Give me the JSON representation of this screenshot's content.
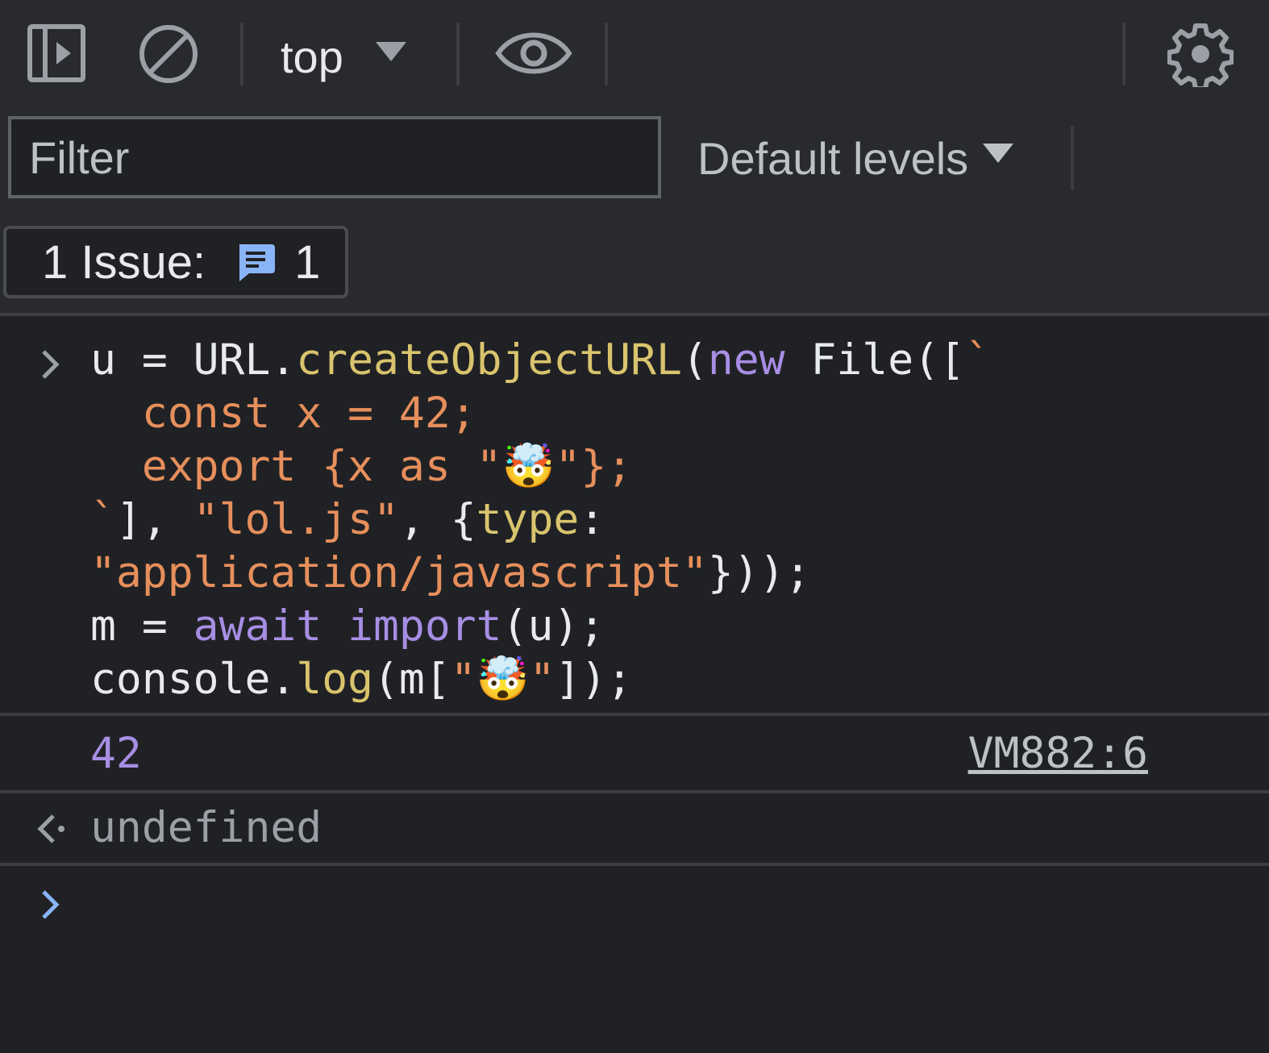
{
  "toolbar": {
    "sidebar_toggle_icon": "sidebar-toggle-icon",
    "clear_icon": "clear-console-icon",
    "context_label": "top",
    "live_expression_icon": "eye-icon",
    "settings_icon": "gear-icon"
  },
  "filter": {
    "placeholder": "Filter",
    "value": "",
    "levels_label": "Default levels"
  },
  "issues": {
    "label": "1 Issue:",
    "icon": "message-icon",
    "count": "1",
    "icon_color": "#8ab4f8"
  },
  "console": {
    "input_code_lines": [
      [
        {
          "text": "u = URL.",
          "kind": "plain"
        },
        {
          "text": "createObjectURL",
          "kind": "fn"
        },
        {
          "text": "(",
          "kind": "punc"
        },
        {
          "text": "new",
          "kind": "kw"
        },
        {
          "text": " File([",
          "kind": "plain"
        },
        {
          "text": "`",
          "kind": "tmpl"
        }
      ],
      [
        {
          "text": "  const x = 42;",
          "kind": "str"
        }
      ],
      [
        {
          "text": "  export {x as \"🤯\"};",
          "kind": "str"
        }
      ],
      [
        {
          "text": "`",
          "kind": "tmpl"
        },
        {
          "text": "], ",
          "kind": "plain"
        },
        {
          "text": "\"lol.js\"",
          "kind": "str"
        },
        {
          "text": ", {",
          "kind": "plain"
        },
        {
          "text": "type",
          "kind": "fn"
        },
        {
          "text": ":",
          "kind": "plain"
        }
      ],
      [
        {
          "text": "\"application/javascript\"",
          "kind": "str"
        },
        {
          "text": "}));",
          "kind": "plain"
        }
      ],
      [
        {
          "text": "m = ",
          "kind": "plain"
        },
        {
          "text": "await",
          "kind": "kw"
        },
        {
          "text": " ",
          "kind": "plain"
        },
        {
          "text": "import",
          "kind": "kw"
        },
        {
          "text": "(u);",
          "kind": "plain"
        }
      ],
      [
        {
          "text": "console.",
          "kind": "plain"
        },
        {
          "text": "log",
          "kind": "fn"
        },
        {
          "text": "(m[",
          "kind": "plain"
        },
        {
          "text": "\"🤯\"",
          "kind": "str"
        },
        {
          "text": "]);",
          "kind": "plain"
        }
      ]
    ],
    "log_value": "42",
    "log_source": "VM882:6",
    "result_value": "undefined",
    "prompt_value": ""
  },
  "colors": {
    "background": "#202124",
    "toolbar": "#292a2d",
    "number": "#a78ee4",
    "keyword": "#a78ee4",
    "function": "#d9c46e",
    "string": "#e68f5c",
    "prompt_active": "#8ab4f8"
  }
}
